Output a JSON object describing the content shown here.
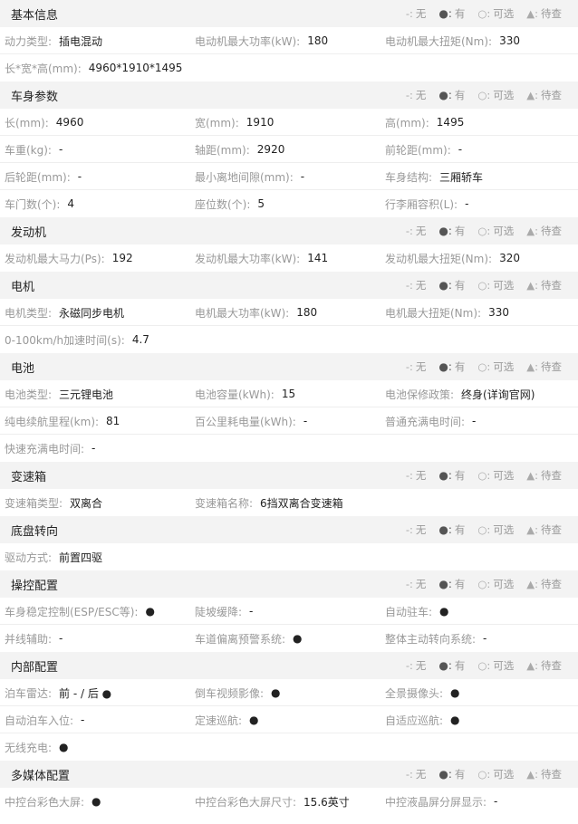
{
  "legend": [
    {
      "sym": "-:",
      "text": "无",
      "dot": false
    },
    {
      "sym": "●:",
      "text": "有",
      "dot": true
    },
    {
      "sym": "○:",
      "text": "可选",
      "dot": false
    },
    {
      "sym": "▲:",
      "text": "待查",
      "dot": false
    }
  ],
  "sections": [
    {
      "title": "基本信息",
      "rows": [
        [
          {
            "k": "动力类型:",
            "v": "插电混动"
          },
          {
            "k": "电动机最大功率(kW):",
            "v": "180"
          },
          {
            "k": "电动机最大扭矩(Nm):",
            "v": "330"
          }
        ],
        [
          {
            "k": "长*宽*高(mm):",
            "v": "4960*1910*1495"
          }
        ]
      ]
    },
    {
      "title": "车身参数",
      "rows": [
        [
          {
            "k": "长(mm):",
            "v": "4960"
          },
          {
            "k": "宽(mm):",
            "v": "1910"
          },
          {
            "k": "高(mm):",
            "v": "1495"
          }
        ],
        [
          {
            "k": "车重(kg):",
            "v": "-"
          },
          {
            "k": "轴距(mm):",
            "v": "2920"
          },
          {
            "k": "前轮距(mm):",
            "v": "-"
          }
        ],
        [
          {
            "k": "后轮距(mm):",
            "v": "-"
          },
          {
            "k": "最小离地间隙(mm):",
            "v": "-"
          },
          {
            "k": "车身结构:",
            "v": "三厢轿车"
          }
        ],
        [
          {
            "k": "车门数(个):",
            "v": "4"
          },
          {
            "k": "座位数(个):",
            "v": "5"
          },
          {
            "k": "行李厢容积(L):",
            "v": "-"
          }
        ]
      ]
    },
    {
      "title": "发动机",
      "rows": [
        [
          {
            "k": "发动机最大马力(Ps):",
            "v": "192"
          },
          {
            "k": "发动机最大功率(kW):",
            "v": "141"
          },
          {
            "k": "发动机最大扭矩(Nm):",
            "v": "320"
          }
        ]
      ]
    },
    {
      "title": "电机",
      "rows": [
        [
          {
            "k": "电机类型:",
            "v": "永磁同步电机"
          },
          {
            "k": "电机最大功率(kW):",
            "v": "180"
          },
          {
            "k": "电机最大扭矩(Nm):",
            "v": "330"
          }
        ],
        [
          {
            "k": "0-100km/h加速时间(s):",
            "v": "4.7"
          }
        ]
      ]
    },
    {
      "title": "电池",
      "rows": [
        [
          {
            "k": "电池类型:",
            "v": "三元锂电池"
          },
          {
            "k": "电池容量(kWh):",
            "v": "15"
          },
          {
            "k": "电池保修政策:",
            "v": "终身(详询官网)"
          }
        ],
        [
          {
            "k": "纯电续航里程(km):",
            "v": "81"
          },
          {
            "k": "百公里耗电量(kWh):",
            "v": "-"
          },
          {
            "k": "普通充满电时间:",
            "v": "-"
          }
        ],
        [
          {
            "k": "快速充满电时间:",
            "v": "-"
          }
        ]
      ]
    },
    {
      "title": "变速箱",
      "rows": [
        [
          {
            "k": "变速箱类型:",
            "v": "双离合"
          },
          {
            "k": "变速箱名称:",
            "v": "6挡双离合变速箱"
          }
        ]
      ]
    },
    {
      "title": "底盘转向",
      "rows": [
        [
          {
            "k": "驱动方式:",
            "v": "前置四驱"
          }
        ]
      ]
    },
    {
      "title": "操控配置",
      "rows": [
        [
          {
            "k": "车身稳定控制(ESP/ESC等):",
            "v": "●"
          },
          {
            "k": "陡坡缓降:",
            "v": "-"
          },
          {
            "k": "自动驻车:",
            "v": "●"
          }
        ],
        [
          {
            "k": "并线辅助:",
            "v": "-"
          },
          {
            "k": "车道偏离预警系统:",
            "v": "●"
          },
          {
            "k": "整体主动转向系统:",
            "v": "-"
          }
        ]
      ]
    },
    {
      "title": "内部配置",
      "rows": [
        [
          {
            "k": "泊车雷达:",
            "v": "前 - / 后 ●"
          },
          {
            "k": "倒车视频影像:",
            "v": "●"
          },
          {
            "k": "全景摄像头:",
            "v": "●"
          }
        ],
        [
          {
            "k": "自动泊车入位:",
            "v": "-"
          },
          {
            "k": "定速巡航:",
            "v": "●"
          },
          {
            "k": "自适应巡航:",
            "v": "●"
          }
        ],
        [
          {
            "k": "无线充电:",
            "v": "●"
          }
        ]
      ]
    },
    {
      "title": "多媒体配置",
      "rows": [
        [
          {
            "k": "中控台彩色大屏:",
            "v": "●"
          },
          {
            "k": "中控台彩色大屏尺寸:",
            "v": "15.6英寸"
          },
          {
            "k": "中控液晶屏分屏显示:",
            "v": "-"
          }
        ]
      ]
    }
  ]
}
